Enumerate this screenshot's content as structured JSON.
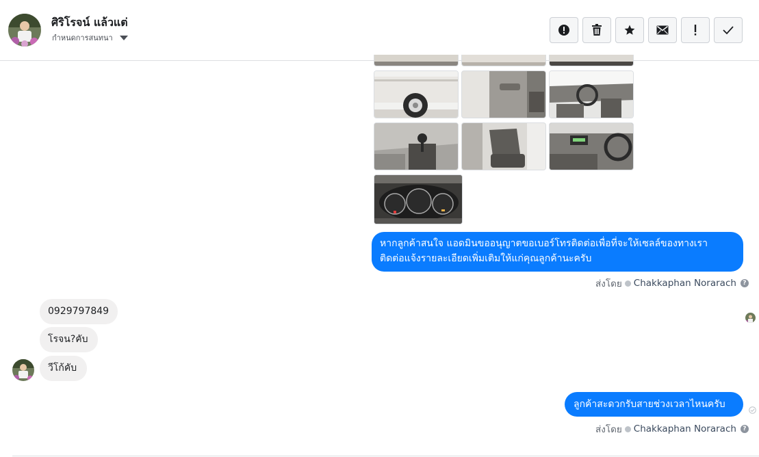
{
  "header": {
    "contact_name": "ศิริโรจน์ แล้วแต่",
    "contact_sub": "กำหนดการสนทนา",
    "avatar": "contact-avatar",
    "actions": [
      {
        "icon": "alert-circle-icon",
        "name": "report-button"
      },
      {
        "icon": "trash-icon",
        "name": "delete-button"
      },
      {
        "icon": "star-icon",
        "name": "star-button"
      },
      {
        "icon": "envelope-icon",
        "name": "mark-unread-button"
      },
      {
        "icon": "exclamation-icon",
        "name": "spam-button"
      },
      {
        "icon": "check-icon",
        "name": "done-button"
      }
    ]
  },
  "photos": [
    {
      "name": "car-photo-wheel",
      "subject": "pickup-wheel"
    },
    {
      "name": "car-photo-door",
      "subject": "open-door"
    },
    {
      "name": "car-photo-dashboard",
      "subject": "dashboard"
    },
    {
      "name": "car-photo-gearshift",
      "subject": "gearshift"
    },
    {
      "name": "car-photo-seat",
      "subject": "driver-seat"
    },
    {
      "name": "car-photo-console",
      "subject": "center-console"
    },
    {
      "name": "car-photo-gauges",
      "subject": "gauge-cluster"
    }
  ],
  "messages": {
    "out_1": "หากลูกค้าสนใจ แอดมินขออนุญาตขอเบอร์โทรติดต่อเพื่อที่จะให้เซลล์ของทางเรา ติดต่อแจ้งรายละเอียดเพิ่มเติมให้แก่คุณลูกค้านะครับ",
    "in_1": "0929797849",
    "in_2": "โรจน?คับ",
    "in_3": "วีโก้คับ",
    "out_2": "ลูกค้าสะดวกรับสายช่วงเวลาไหนครับ"
  },
  "sent_by": {
    "label": "ส่งโดย",
    "name": "Chakkaphan Norarach",
    "help_glyph": "?"
  },
  "colors": {
    "outgoing_bubble": "#0a7cff",
    "incoming_bubble": "#f1f0f0",
    "border": "#dddfe2"
  }
}
